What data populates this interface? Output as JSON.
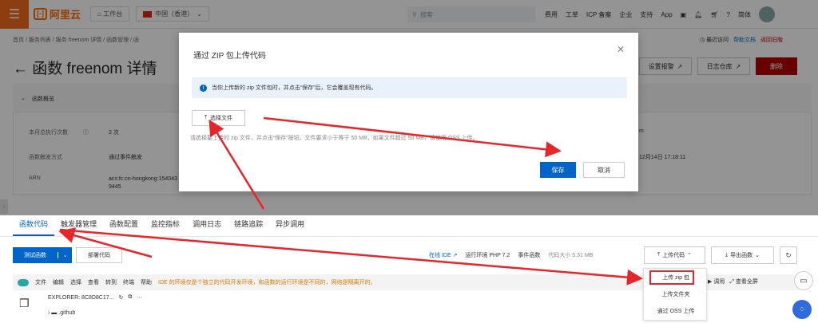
{
  "topbar": {
    "logo_text": "阿里云",
    "workbench": "工作台",
    "region": "中国（香港）",
    "search_placeholder": "搜索",
    "links": [
      "费用",
      "工单",
      "ICP 备案",
      "企业",
      "支持",
      "App"
    ],
    "lang": "简体"
  },
  "breadcrumb": "首页 / 服务列表 / 服务 freenom 详情 / 函数管理 / 函",
  "right_links": {
    "recent": "最近访问",
    "help": "帮助文档",
    "back": "返回旧版"
  },
  "page_title": "函数 freenom 详情",
  "header_buttons": {
    "alarm": "设置报警",
    "logstore": "日志仓库",
    "delete": "删除"
  },
  "overview": {
    "section": "函数概览",
    "fields": [
      {
        "label": "本月总执行次数",
        "value": "2 次"
      },
      {
        "label": "函数触发方式",
        "value": "通过事件触发"
      },
      {
        "label": "ARN",
        "value": "acs:fc:cn-hongkong:1540439445"
      }
    ],
    "right_value_1": "m",
    "right_value_2": "12月14日 17:18:11"
  },
  "modal": {
    "title": "通过 ZIP 包上传代码",
    "info": "当你上传新的 zip 文件包时，并点击“保存”后，它会覆盖现有代码。",
    "choose_file": "选择文件",
    "hint": "请选择要上传的 zip 文件，并点击“保存”按钮。文件要求小于等于 50 MB，如果文件超过 50 MB，请使用 OSS 上传。",
    "save": "保存",
    "cancel": "取消"
  },
  "tabs": [
    "函数代码",
    "触发器管理",
    "函数配置",
    "监控指标",
    "调用日志",
    "链路追踪",
    "异步调用"
  ],
  "toolbar": {
    "test": "测试函数",
    "deploy": "部署代码",
    "online_ide": "在线 IDE",
    "runtime": "运行环境 PHP 7.2",
    "event_fn": "事件函数",
    "code_size": "代码大小 5.31 MB",
    "upload": "上传代码",
    "export": "导出函数"
  },
  "ide": {
    "menu": [
      "文件",
      "编辑",
      "选择",
      "查看",
      "转到",
      "终端",
      "帮助"
    ],
    "warning": "IDE 的环境仅是个独立的代码开发环境，和函数的运行环境是不同的，网络是隔离开的。",
    "explorer": "EXPLORER: 8C8D8C17...",
    "github": ".github",
    "invoke": "调用",
    "fullscreen": "查看全屏"
  },
  "upload_menu": [
    "上传 zip 包",
    "上传文件夹",
    "通过 OSS 上传"
  ],
  "colors": {
    "accent": "#0064c8",
    "brand": "#ff6a00",
    "danger": "#b30000",
    "annotation": "#e5262b"
  }
}
